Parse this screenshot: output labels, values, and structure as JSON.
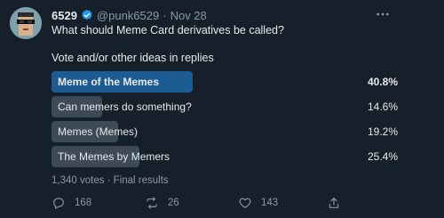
{
  "tweet": {
    "display_name": "6529",
    "handle": "@punk6529",
    "separator": "·",
    "time": "Nov 28",
    "more_icon": "more-horizontal-icon",
    "question": "What should Meme Card derivatives be called?",
    "subtext": "Vote and/or other ideas in replies"
  },
  "poll": {
    "options": [
      {
        "label": "Meme of the Memes",
        "percent_text": "40.8%",
        "percent": 40.8,
        "winner": true
      },
      {
        "label": "Can memers do something?",
        "percent_text": "14.6%",
        "percent": 14.6,
        "winner": false
      },
      {
        "label": "Memes (Memes)",
        "percent_text": "19.2%",
        "percent": 19.2,
        "winner": false
      },
      {
        "label": "The Memes by Memers",
        "percent_text": "25.4%",
        "percent": 25.4,
        "winner": false
      }
    ],
    "summary": "1,340 votes · Final results"
  },
  "actions": {
    "replies": "168",
    "retweets": "26",
    "likes": "143",
    "share_icon": "share-icon"
  },
  "colors": {
    "background": "#15202b",
    "winner_bar": "#1d5c93",
    "bar": "#3d4a57",
    "muted_text": "#8b98a5",
    "verified": "#1d9bf0"
  }
}
